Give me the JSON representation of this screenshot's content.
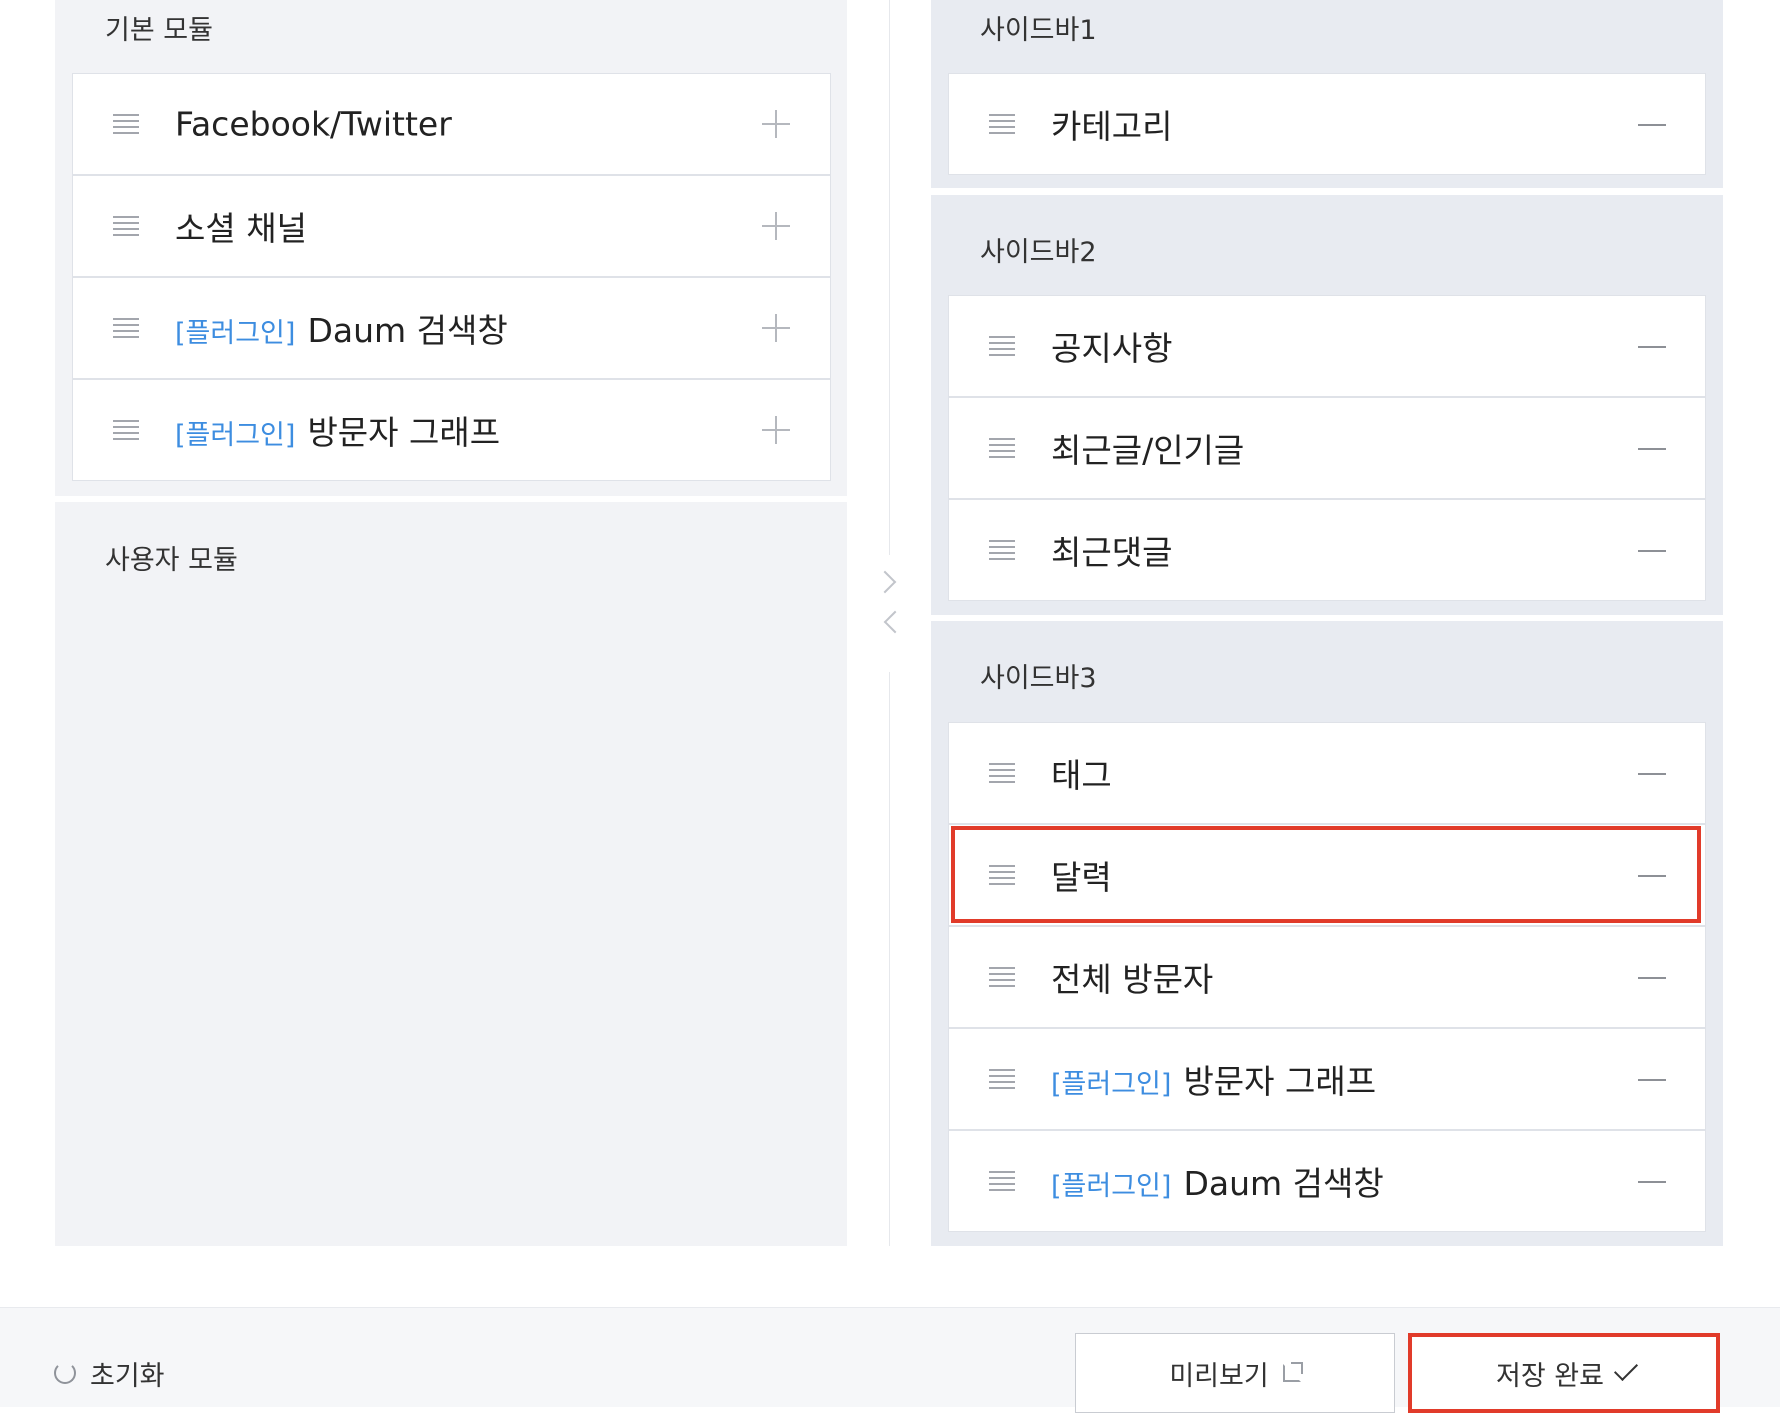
{
  "basic_modules": {
    "title": "기본 모듈",
    "items": [
      {
        "label": "Facebook/Twitter"
      },
      {
        "label": "소셜 채널"
      },
      {
        "tag": "[플러그인]",
        "label": "Daum 검색창"
      },
      {
        "tag": "[플러그인]",
        "label": "방문자 그래프"
      }
    ]
  },
  "user_modules": {
    "title": "사용자 모듈"
  },
  "sidebar1": {
    "title": "사이드바1",
    "items": [
      {
        "label": "카테고리"
      }
    ]
  },
  "sidebar2": {
    "title": "사이드바2",
    "items": [
      {
        "label": "공지사항"
      },
      {
        "label": "최근글/인기글"
      },
      {
        "label": "최근댓글"
      }
    ]
  },
  "sidebar3": {
    "title": "사이드바3",
    "items": [
      {
        "label": "태그"
      },
      {
        "label": "달력"
      },
      {
        "label": "전체 방문자"
      },
      {
        "tag": "[플러그인]",
        "label": "방문자 그래프"
      },
      {
        "tag": "[플러그인]",
        "label": "Daum 검색창"
      }
    ]
  },
  "footer": {
    "reset_label": "초기화",
    "preview_label": "미리보기",
    "save_label": "저장 완료"
  },
  "colors": {
    "plugin_tag": "#3d8de0",
    "highlight": "#e13b2a"
  }
}
